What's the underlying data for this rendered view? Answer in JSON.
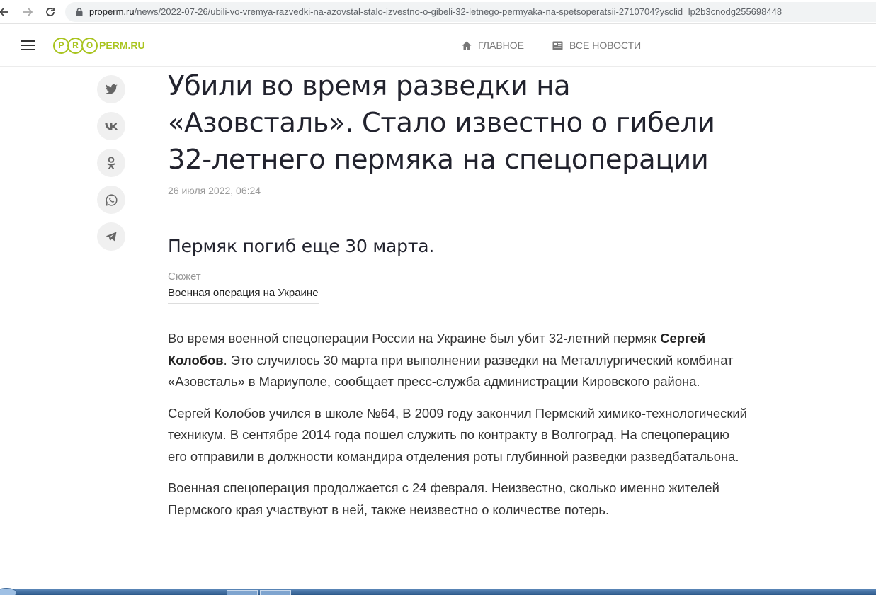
{
  "browser": {
    "url_host": "properm.ru",
    "url_path": "/news/2022-07-26/ubili-vo-vremya-razvedki-na-azovstal-stalo-izvestno-o-gibeli-32-letnego-permyaka-na-spetsoperatsii-2710704?ysclid=lp2b3cnodg255698448"
  },
  "header": {
    "logo_letters": [
      "P",
      "R",
      "O"
    ],
    "logo_text": "PERM.RU",
    "nav": [
      {
        "label": "ГЛАВНОЕ",
        "icon": "home-icon"
      },
      {
        "label": "ВСЕ НОВОСТИ",
        "icon": "news-icon"
      }
    ]
  },
  "share": [
    "twitter-icon",
    "vk-icon",
    "odnoklassniki-icon",
    "whatsapp-icon",
    "telegram-icon"
  ],
  "article": {
    "title": "Убили во время разведки на «Азовсталь». Стало известно о гибели 32-летнего пермяка на спецоперации",
    "date": "26 июля 2022, 06:24",
    "lead": "Пермяк погиб еще 30 марта.",
    "plot_label": "Сюжет",
    "plot_link": "Военная операция на Украине",
    "p1_before": "Во время военной спецоперации России на Украине был убит 32-летний пермяк ",
    "p1_name": "Сергей Колобов",
    "p1_after": ". Это случилось 30 марта при выполнении разведки на Металлургический комбинат «Азовсталь» в Мариуполе, сообщает пресс-служба администрации Кировского района.",
    "p2": "Сергей Колобов учился в школе №64, В 2009 году закончил Пермский химико-технологический техникум. В сентябре 2014 года пошел служить по контракту в Волгоград. На спецоперацию его отправили в должности командира отделения роты глубинной разведки разведбатальона.",
    "p3": "Военная спецоперация продолжается с 24 февраля. Неизвестно, сколько именно жителей Пермского края участвуют в ней, также неизвестно о количестве потерь."
  },
  "colors": {
    "brand": "#a9c41f",
    "title": "#22232e",
    "muted": "#999999"
  }
}
